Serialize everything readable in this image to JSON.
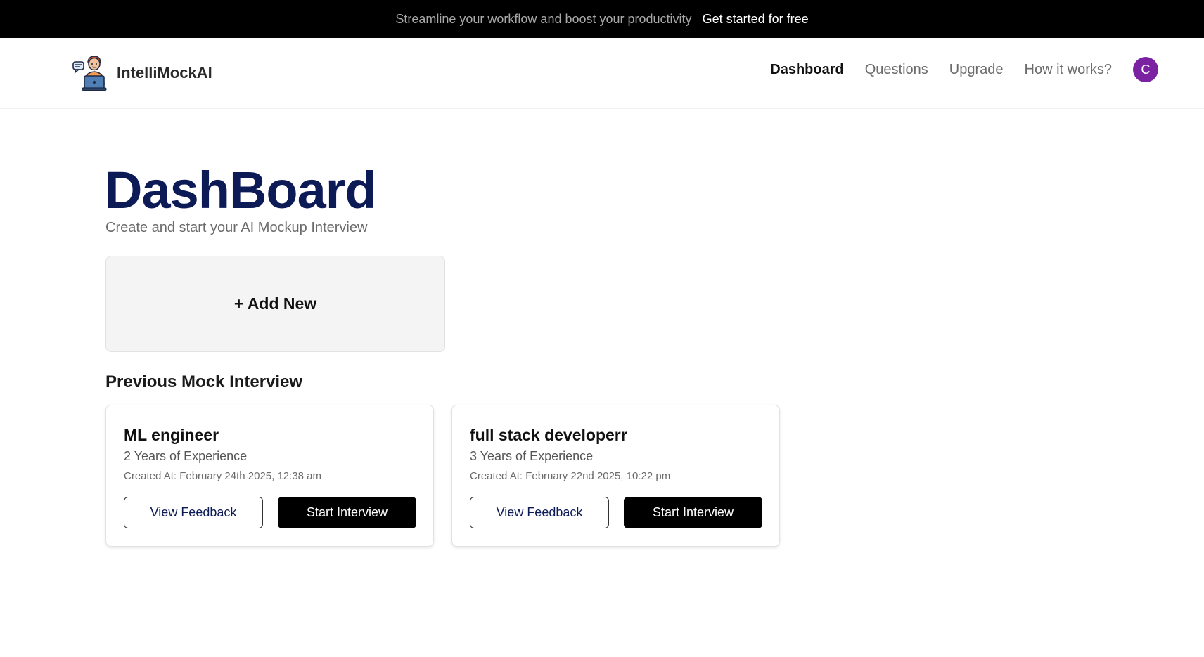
{
  "announcement": {
    "message": "Streamline your workflow and boost your productivity",
    "cta": "Get started for free"
  },
  "brand": {
    "name": "IntelliMockAI",
    "logo_icon": "interviewer-laptop-icon"
  },
  "nav": {
    "items": [
      {
        "label": "Dashboard",
        "active": true
      },
      {
        "label": "Questions",
        "active": false
      },
      {
        "label": "Upgrade",
        "active": false
      },
      {
        "label": "How it works?",
        "active": false
      }
    ],
    "avatar_initial": "C"
  },
  "page": {
    "title": "DashBoard",
    "subtitle": "Create and start your AI Mockup Interview"
  },
  "add_new": {
    "label": "+ Add New"
  },
  "previous": {
    "title": "Previous Mock Interview",
    "interviews": [
      {
        "role": "ML engineer",
        "experience": "2 Years of Experience",
        "created": "Created At: February 24th 2025, 12:38 am",
        "feedback_label": "View Feedback",
        "start_label": "Start Interview"
      },
      {
        "role": "full stack developerr",
        "experience": "3 Years of Experience",
        "created": "Created At: February 22nd 2025, 10:22 pm",
        "feedback_label": "View Feedback",
        "start_label": "Start Interview"
      }
    ]
  },
  "colors": {
    "announce_bg": "#000000",
    "title": "#0c1a56",
    "avatar": "#7b22a3",
    "primary_button": "#000000"
  }
}
